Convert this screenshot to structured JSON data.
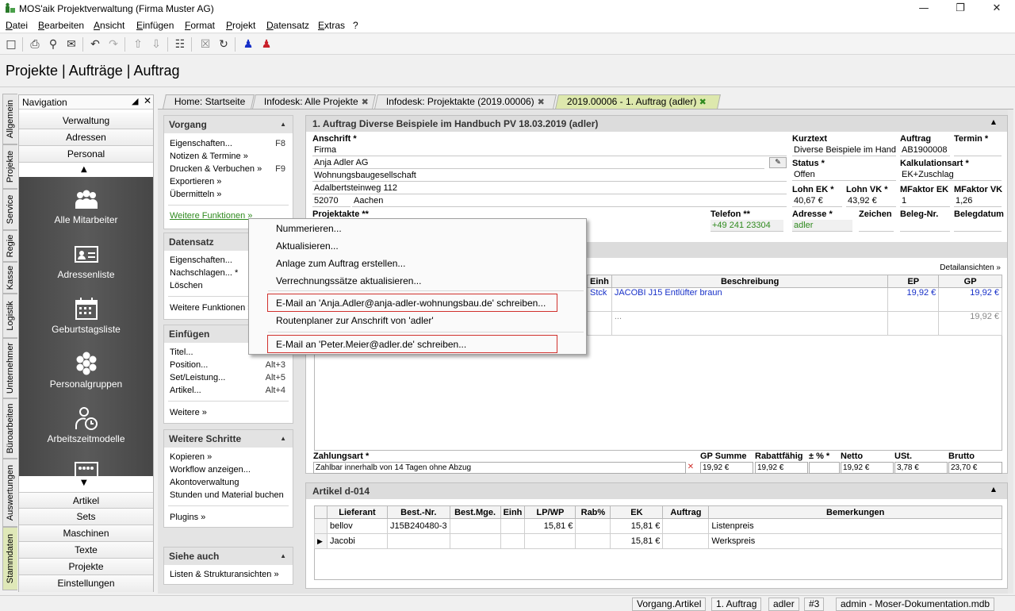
{
  "window": {
    "title": "MOS'aik Projektverwaltung (Firma Muster AG)"
  },
  "menu": [
    "Datei",
    "Bearbeiten",
    "Ansicht",
    "Einfügen",
    "Format",
    "Projekt",
    "Datensatz",
    "Extras",
    "?"
  ],
  "page_title": "Projekte | Aufträge | Auftrag",
  "vertical_tabs": [
    "Allgemein",
    "Projekte",
    "Service",
    "Regie",
    "Kasse",
    "Logistik",
    "Unternehmer",
    "Büroarbeiten",
    "Auswertungen",
    "Stammdaten"
  ],
  "navigation": {
    "title": "Navigation",
    "top_items": [
      "Verwaltung",
      "Adressen",
      "Personal"
    ],
    "big_items": [
      "Alle Mitarbeiter",
      "Adressenliste",
      "Geburtstagsliste",
      "Personalgruppen",
      "Arbeitszeitmodelle"
    ],
    "bottom_items": [
      "Artikel",
      "Sets",
      "Maschinen",
      "Texte",
      "Projekte",
      "Einstellungen"
    ]
  },
  "doc_tabs": [
    "Home: Startseite",
    "Infodesk: Alle Projekte",
    "Infodesk: Projektakte (2019.00006)",
    "2019.00006 - 1. Auftrag (adler)"
  ],
  "taskpane": {
    "vorgang": {
      "title": "Vorgang",
      "items": [
        "Eigenschaften...",
        "Notizen & Termine »",
        "Drucken & Verbuchen »",
        "Exportieren »",
        "Übermitteln »"
      ],
      "keys": [
        "F8",
        "F9"
      ],
      "more": "Weitere Funktionen »"
    },
    "datensatz": {
      "title": "Datensatz",
      "items": [
        "Eigenschaften...",
        "Nachschlagen...",
        "Löschen"
      ],
      "star": "*",
      "more": "Weitere Funktionen »"
    },
    "einfuegen": {
      "title": "Einfügen",
      "items": [
        "Titel...",
        "Position...",
        "Set/Leistung...",
        "Artikel..."
      ],
      "keys": [
        "Alt+3",
        "Alt+5",
        "Alt+4"
      ],
      "more": "Weitere »"
    },
    "schritte": {
      "title": "Weitere Schritte",
      "items": [
        "Kopieren »",
        "Workflow anzeigen...",
        "Akontoverwaltung",
        "Stunden und Material buchen"
      ],
      "more": "Plugins »"
    },
    "siehe": {
      "title": "Siehe auch",
      "items": [
        "Listen & Strukturansichten »"
      ]
    }
  },
  "order": {
    "header": "1. Auftrag Diverse Beispiele im Handbuch PV 18.03.2019 (adler)",
    "anschrift_label": "Anschrift *",
    "anschrift": [
      "Firma",
      "Anja Adler AG",
      "Wohnungsbaugesellschaft",
      "Adalbertsteinweg 112"
    ],
    "plz": "52070",
    "ort": "Aachen",
    "projektakte_label": "Projektakte **",
    "telefon_label": "Telefon **",
    "telefon": "+49 241 23304",
    "kurztext_label": "Kurztext",
    "kurztext": "Diverse Beispiele im Handb",
    "auftrag_label": "Auftrag",
    "auftrag": "AB1900008",
    "termin_label": "Termin *",
    "status_label": "Status *",
    "status": "Offen",
    "kalk_label": "Kalkulationsart *",
    "kalk": "EK+Zuschlag",
    "lohnek_label": "Lohn EK *",
    "lohnek": "40,67 €",
    "lohnvk_label": "Lohn VK *",
    "lohnvk": "43,92 €",
    "mfek_label": "MFaktor EK",
    "mfek": "1",
    "mfvk_label": "MFaktor VK",
    "mfvk": "1,26",
    "adresse_label": "Adresse *",
    "adresse": "adler",
    "zeichen_label": "Zeichen",
    "belegnr_label": "Beleg-Nr.",
    "belegdatum_label": "Belegdatum"
  },
  "positions": {
    "detail_link": "Detailansichten »",
    "headers": [
      "Einh",
      "Beschreibung",
      "EP",
      "GP"
    ],
    "rows": [
      {
        "einh": "Stck",
        "beschreibung": "JACOBI J15 Entlüfter braun",
        "ep": "19,92 €",
        "gp": "19,92 €"
      },
      {
        "einh": "",
        "beschreibung": "...",
        "ep": "",
        "gp": "19,92 €"
      }
    ]
  },
  "totals": {
    "zahlungsart_label": "Zahlungsart *",
    "zahlungsart": "Zahlbar innerhalb von 14 Tagen ohne Abzug",
    "gpsumme_label": "GP Summe",
    "gpsumme": "19,92 €",
    "rabatt_label": "Rabattfähig",
    "rabatt": "19,92 €",
    "proz_label": "± % *",
    "netto_label": "Netto",
    "netto": "19,92 €",
    "ust_label": "USt.",
    "ust": "3,78 €",
    "brutto_label": "Brutto",
    "brutto": "23,70 €"
  },
  "artikel": {
    "header": "Artikel d-014",
    "headers": [
      "Lieferant",
      "Best.-Nr.",
      "Best.Mge.",
      "Einh",
      "LP/WP",
      "Rab%",
      "EK",
      "Auftrag",
      "Bemerkungen"
    ],
    "rows": [
      {
        "lieferant": "bellov",
        "bestnr": "J15B240480-3",
        "lp": "15,81 €",
        "ek": "15,81 €",
        "bem": "Listenpreis"
      },
      {
        "lieferant": "Jacobi",
        "bestnr": "",
        "lp": "",
        "ek": "15,81 €",
        "bem": "Werkspreis"
      }
    ]
  },
  "context_menu": {
    "items": [
      "Nummerieren...",
      "Aktualisieren...",
      "Anlage zum Auftrag erstellen...",
      "Verrechnungssätze aktualisieren...",
      "E-Mail an 'Anja.Adler@anja-adler-wohnungsbau.de' schreiben...",
      "Routenplaner zur Anschrift von 'adler'",
      "E-Mail an 'Peter.Meier@adler.de' schreiben..."
    ]
  },
  "status_bar": [
    "Vorgang.Artikel",
    "1. Auftrag",
    "adler",
    "#3",
    "admin - Moser-Dokumentation.mdb"
  ],
  "colors": {
    "accent_green": "#2f8a1e",
    "link_blue": "#1730c8",
    "highlight_red": "#d0312d",
    "active_tab": "#dde8ad"
  }
}
